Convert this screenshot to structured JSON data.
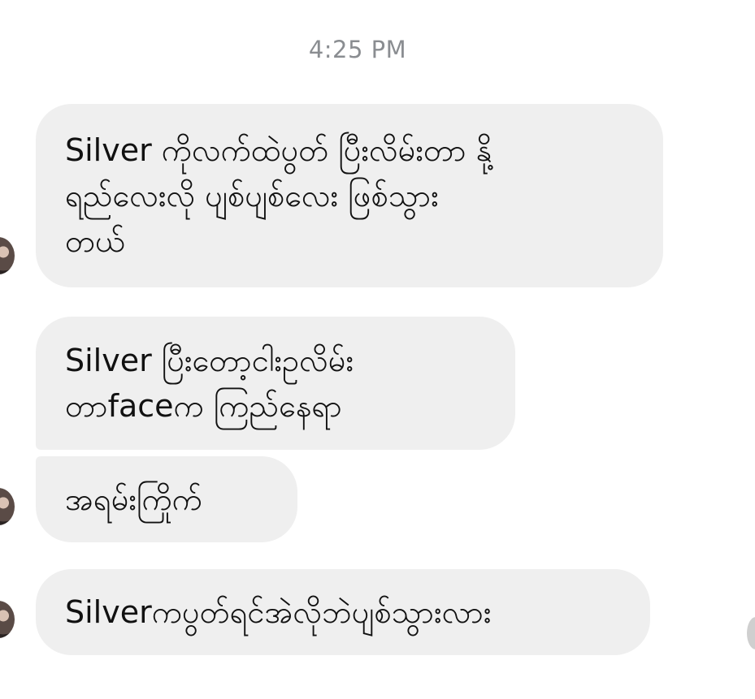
{
  "timestamp": "4:25 PM",
  "messages": [
    {
      "text": "Silver ကိုလက်ထဲပွတ် ပြီးလိမ်းတာ နို့\nရည်လေးလို ပျစ်ပျစ်လေး ဖြစ်သွား\nတယ်"
    },
    {
      "text": "Silver  ပြီးတော့ငါးဥလိမ်း\nတာfaceက ကြည်နေရာ"
    },
    {
      "text": "အရမ်းကြိုက်"
    },
    {
      "text": "Silverကပွတ်ရင်အဲလိုဘဲပျစ်သွားလား"
    }
  ]
}
